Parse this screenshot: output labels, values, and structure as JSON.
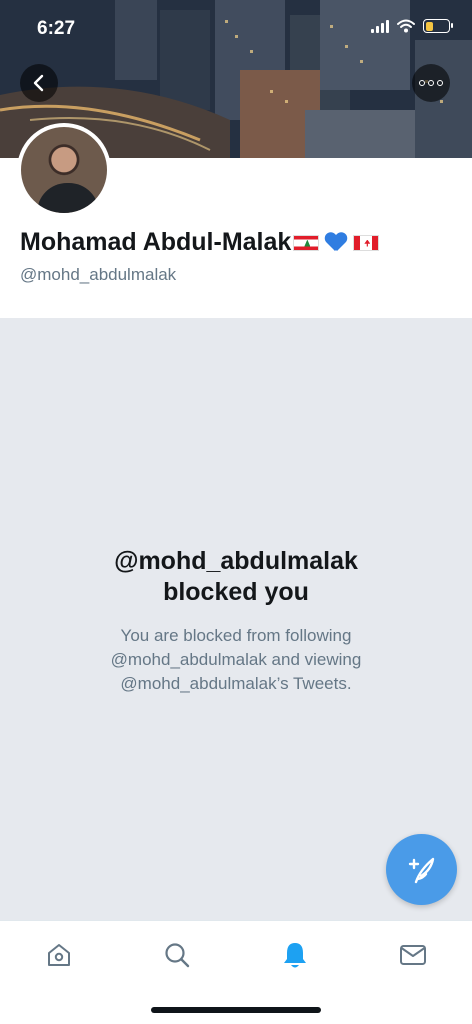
{
  "status_bar": {
    "time": "6:27",
    "battery_level": 0.35
  },
  "header": {
    "back_icon": "chevron-left-icon",
    "more_icon": "more-dots-icon"
  },
  "profile": {
    "name": "Mohamad Abdul-Malak",
    "name_emoji": [
      "lebanon-flag",
      "blue-heart",
      "canada-flag"
    ],
    "handle": "@mohd_abdulmalak"
  },
  "blocked": {
    "title_line1": "@mohd_abdulmalak",
    "title_line2": "blocked you",
    "message_line1": "You are blocked from following",
    "message_line2": "@mohd_abdulmalak and viewing",
    "message_line3": "@mohd_abdulmalak’s Tweets."
  },
  "compose": {
    "icon": "compose-tweet-icon"
  },
  "tab_bar": {
    "tabs": [
      {
        "name": "home",
        "icon": "home-icon",
        "active": false
      },
      {
        "name": "search",
        "icon": "search-icon",
        "active": false
      },
      {
        "name": "notifications",
        "icon": "bell-icon",
        "active": true
      },
      {
        "name": "messages",
        "icon": "mail-icon",
        "active": false
      }
    ]
  },
  "colors": {
    "accent": "#1da1f2",
    "fab": "#4a9be8",
    "muted_text": "#657786",
    "blocked_bg": "#e6e9ee"
  }
}
